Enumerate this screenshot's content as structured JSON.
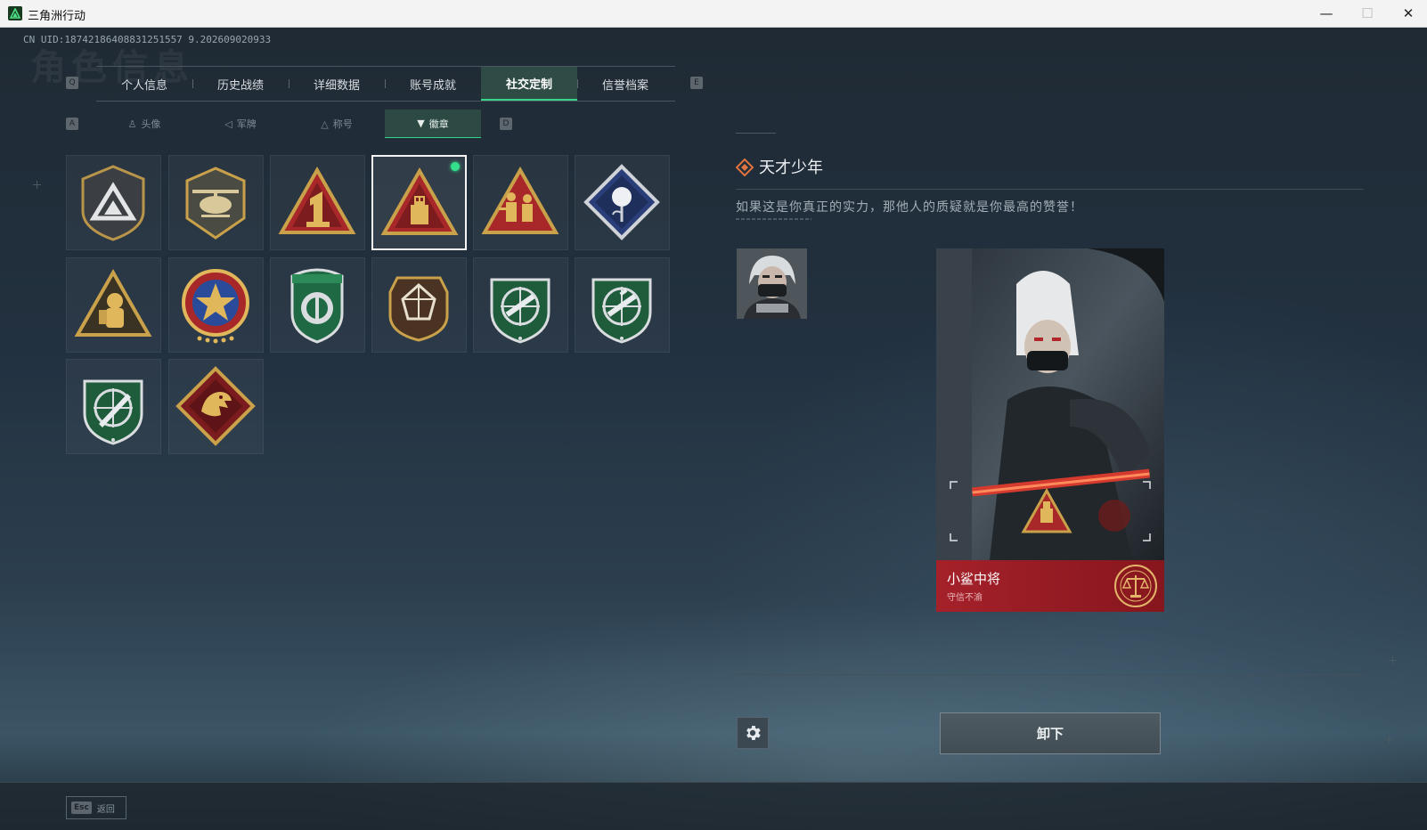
{
  "window": {
    "title": "三角洲行动",
    "minimize": "—",
    "maximize": "☐",
    "close": "✕"
  },
  "header": {
    "uid": "CN UID:18742186408831251557 9.202609020933",
    "bg_title": "角色信息"
  },
  "main_tabs": {
    "prev_key": "Q",
    "next_key": "E",
    "items": [
      {
        "label": "个人信息"
      },
      {
        "label": "历史战绩"
      },
      {
        "label": "详细数据"
      },
      {
        "label": "账号成就"
      },
      {
        "label": "社交定制",
        "active": true
      },
      {
        "label": "信誉档案"
      }
    ]
  },
  "sub_tabs": {
    "prev_key": "A",
    "next_key": "D",
    "items": [
      {
        "label": "头像",
        "icon": "person-icon"
      },
      {
        "label": "军牌",
        "icon": "dogtag-icon"
      },
      {
        "label": "称号",
        "icon": "title-icon"
      },
      {
        "label": "徽章",
        "icon": "badge-icon",
        "active": true
      }
    ]
  },
  "badges": [
    {
      "name": "triangle-shield-badge",
      "selected": false
    },
    {
      "name": "helicopter-badge",
      "selected": false
    },
    {
      "name": "number-one-badge",
      "selected": false
    },
    {
      "name": "usb-triangle-badge",
      "selected": true,
      "equipped": true
    },
    {
      "name": "soldiers-triangle-badge",
      "selected": false
    },
    {
      "name": "rose-diamond-badge",
      "selected": false
    },
    {
      "name": "astronaut-triangle-badge",
      "selected": false
    },
    {
      "name": "star-medal-badge",
      "selected": false
    },
    {
      "name": "green-emblem-badge",
      "selected": false
    },
    {
      "name": "gem-shield-badge",
      "selected": false
    },
    {
      "name": "rifle-crosshair-badge-1",
      "selected": false
    },
    {
      "name": "rifle-crosshair-badge-2",
      "selected": false
    },
    {
      "name": "knife-crosshair-badge",
      "selected": false
    },
    {
      "name": "dragon-diamond-badge",
      "selected": false
    }
  ],
  "detail": {
    "name": "天才少年",
    "description": "如果这是你真正的实力，那他人的质疑就是你最高的赞誉！",
    "card": {
      "name": "小鲨中将",
      "subtitle": "守信不渝"
    },
    "unequip_label": "卸下"
  },
  "footer": {
    "esc_key": "Esc",
    "esc_label": "返回"
  },
  "colors": {
    "accent_green": "#36d38a",
    "card_red": "#a5212a",
    "badge_gold": "#c9a14a"
  }
}
